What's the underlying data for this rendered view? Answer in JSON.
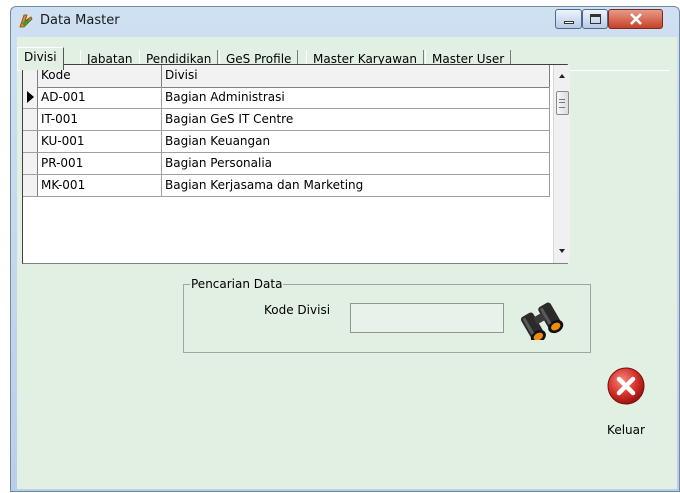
{
  "window": {
    "title": "Data Master",
    "controls": [
      "minimize",
      "maximize",
      "close"
    ]
  },
  "tabs": [
    {
      "label": "Divisi",
      "active": true
    },
    {
      "label": "Jabatan",
      "active": false
    },
    {
      "label": "Pendidikan",
      "active": false
    },
    {
      "label": "GeS Profile",
      "active": false
    },
    {
      "label": "Master Karyawan",
      "active": false
    },
    {
      "label": "Master User",
      "active": false
    }
  ],
  "grid": {
    "columns": [
      "Kode",
      "Divisi"
    ],
    "rows": [
      {
        "kode": "AD-001",
        "divisi": "Bagian Administrasi",
        "current": true
      },
      {
        "kode": "IT-001",
        "divisi": "Bagian GeS IT Centre",
        "current": false
      },
      {
        "kode": "KU-001",
        "divisi": "Bagian Keuangan",
        "current": false
      },
      {
        "kode": "PR-001",
        "divisi": "Bagian Personalia",
        "current": false
      },
      {
        "kode": "MK-001",
        "divisi": "Bagian Kerjasama dan Marketing",
        "current": false
      }
    ]
  },
  "search": {
    "group_title": "Pencarian Data",
    "label": "Kode Divisi",
    "value": "",
    "button_icon": "binoculars-icon"
  },
  "exit": {
    "label": "Keluar",
    "icon": "close-circle-icon",
    "color": "#d8322c"
  }
}
